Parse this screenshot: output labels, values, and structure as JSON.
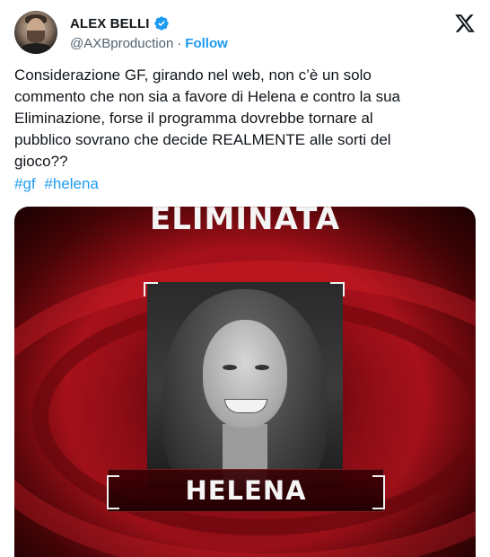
{
  "author": {
    "display_name": "ALEX BELLI",
    "handle": "@AXBproduction",
    "separator": "·",
    "follow_label": "Follow",
    "verified": true
  },
  "tweet": {
    "text": "Considerazione GF, girando nel web,  non c’è un solo\ncommento che non sia a favore di Helena e contro la sua\nEliminazione, forse il programma dovrebbe tornare al\npubblico sovrano che decide REALMENTE alle sorti del\ngioco??",
    "hashtags": [
      "#gf",
      "#helena"
    ]
  },
  "media": {
    "headline": "ELIMINATA",
    "nameplate": "HELENA"
  },
  "colors": {
    "link": "#1d9bf0",
    "verified_badge": "#1d9bf0",
    "secondary_text": "#536471",
    "media_red": "#b5121c"
  },
  "icons": {
    "verified": "verified-badge-icon",
    "platform": "x-logo-icon"
  }
}
